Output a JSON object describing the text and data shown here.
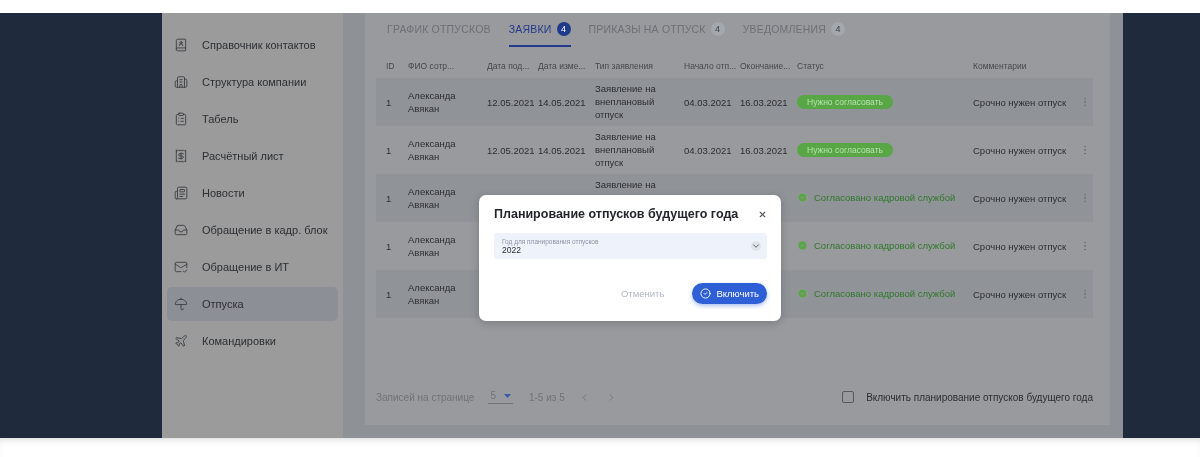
{
  "sidebar": {
    "items": [
      {
        "label": "Справочник контактов",
        "selected": false
      },
      {
        "label": "Структура компании",
        "selected": false
      },
      {
        "label": "Табель",
        "selected": false
      },
      {
        "label": "Расчётный лист",
        "selected": false
      },
      {
        "label": "Новости",
        "selected": false
      },
      {
        "label": "Обращение в кадр. блок",
        "selected": false
      },
      {
        "label": "Обращение в ИТ",
        "selected": false
      },
      {
        "label": "Отпуска",
        "selected": true
      },
      {
        "label": "Командировки",
        "selected": false
      }
    ]
  },
  "tabs": [
    {
      "label": "ГРАФИК ОТПУСКОВ",
      "selected": false
    },
    {
      "label": "ЗАЯВКИ",
      "badge": "4",
      "selected": true
    },
    {
      "label": "ПРИКАЗЫ НА ОТПУСК",
      "badge": "4",
      "selected": false
    },
    {
      "label": "УВЕДОМЛЕНИЯ",
      "badge": "4",
      "selected": false
    }
  ],
  "table": {
    "columns": [
      "ID",
      "ФИО сотр...",
      "Дата под...",
      "Дата изме...",
      "Тип заявления",
      "Начало отп...",
      "Окончание...",
      "Статус",
      "Комментарии"
    ],
    "rows": [
      {
        "id": "1",
        "name": "Александа Авякан",
        "submitted": "12.05.2021",
        "changed": "14.05.2021",
        "type": "Заявление на внеплановый отпуск",
        "start": "04.03.2021",
        "end": "16.03.2021",
        "status": {
          "kind": "pending",
          "label": "Нужно согласовать"
        },
        "comment": "Срочно нужен отпуск"
      },
      {
        "id": "1",
        "name": "Александа Авякан",
        "submitted": "12.05.2021",
        "changed": "14.05.2021",
        "type": "Заявление на внеплановый отпуск",
        "start": "04.03.2021",
        "end": "16.03.2021",
        "status": {
          "kind": "pending",
          "label": "Нужно согласовать"
        },
        "comment": "Срочно нужен отпуск"
      },
      {
        "id": "1",
        "name": "Александа Авякан",
        "type": "Заявление на",
        "status": {
          "kind": "approved",
          "label": "Согласовано кадровой службой"
        },
        "comment": "Срочно нужен отпуск"
      },
      {
        "id": "1",
        "name": "Александа Авякан",
        "status": {
          "kind": "approved",
          "label": "Согласовано кадровой службой"
        },
        "comment": "Срочно нужен отпуск"
      },
      {
        "id": "1",
        "name": "Александа Авякан",
        "status": {
          "kind": "approved",
          "label": "Согласовано кадровой службой"
        },
        "comment": "Срочно нужен отпуск"
      }
    ]
  },
  "pagination": {
    "label": "Записей на странице",
    "per_page": "5",
    "range": "1-5 из 5"
  },
  "planning_toggle": {
    "label": "Включить планирование отпусков будущего года",
    "checked": false
  },
  "modal": {
    "title": "Планирование отпусков будущего года",
    "field": {
      "label": "Год для планирования отпусков",
      "value": "2022"
    },
    "buttons": [
      {
        "label": "Отменить",
        "kind": "secondary"
      },
      {
        "label": "Включить",
        "kind": "primary"
      }
    ]
  }
}
